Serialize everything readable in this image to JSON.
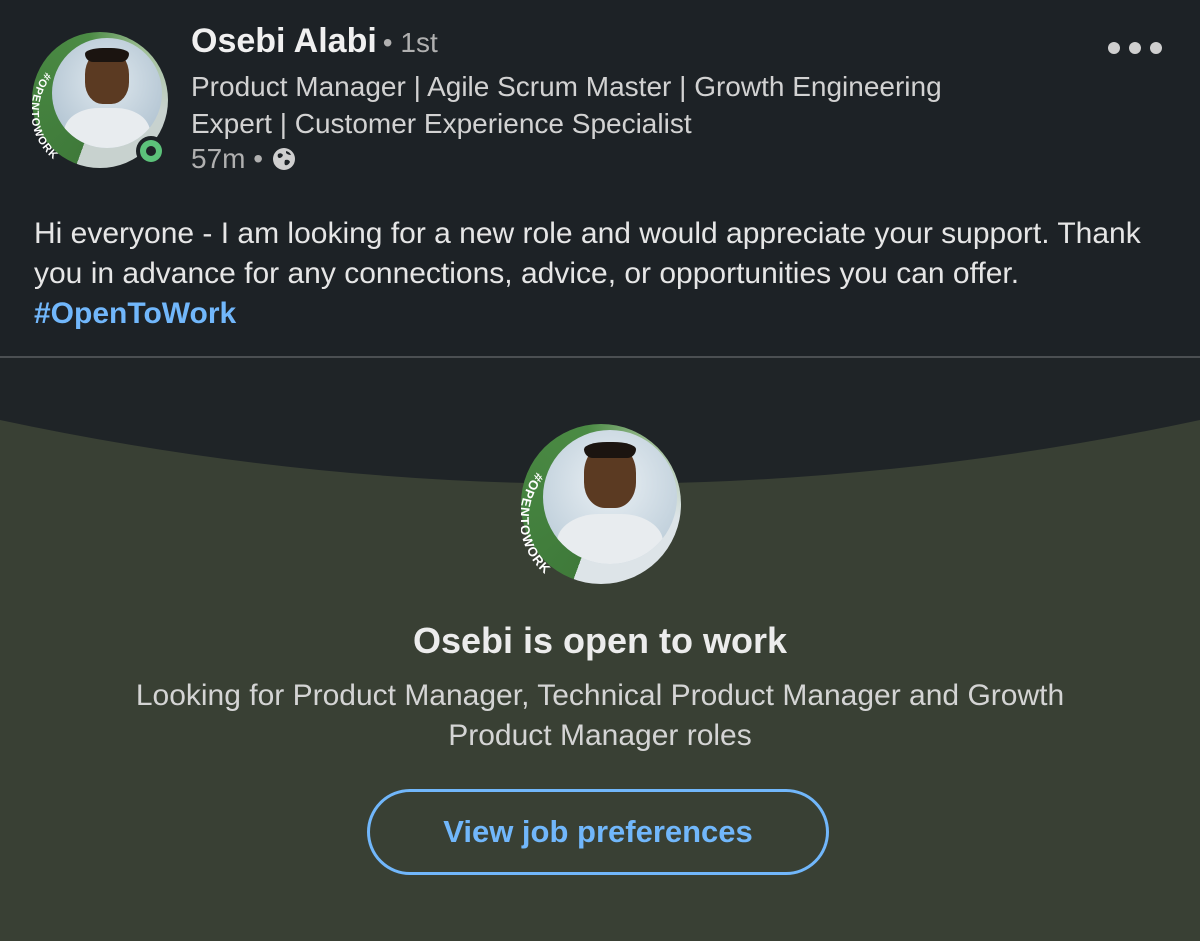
{
  "post": {
    "author_name": "Osebi Alabi",
    "connection_degree": "• 1st",
    "headline": "Product Manager | Agile Scrum Master | Growth Engineering Expert | Customer Experience Specialist",
    "time_ago": "57m •",
    "visibility_icon": "globe-icon",
    "body_text": "Hi everyone - I am looking for a new role and would appreciate your support. Thank you in advance for any connections, advice, or opportunities you can offer. ",
    "hashtag": "#OpenToWork",
    "avatar_frame_text": "#OPENTOWORK",
    "more_icon": "more-horizontal-icon"
  },
  "open_to_work_card": {
    "frame_text": "#OPENTOWORK",
    "title": "Osebi is open to work",
    "description": "Looking for Product Manager, Technical Product Manager and Growth Product Manager roles",
    "button_label": "View job preferences"
  },
  "colors": {
    "background": "#1d2226",
    "card_background": "#394034",
    "accent_link": "#71b7fb",
    "frame_green": "#4b8b44",
    "online_green": "#5cc27a"
  }
}
